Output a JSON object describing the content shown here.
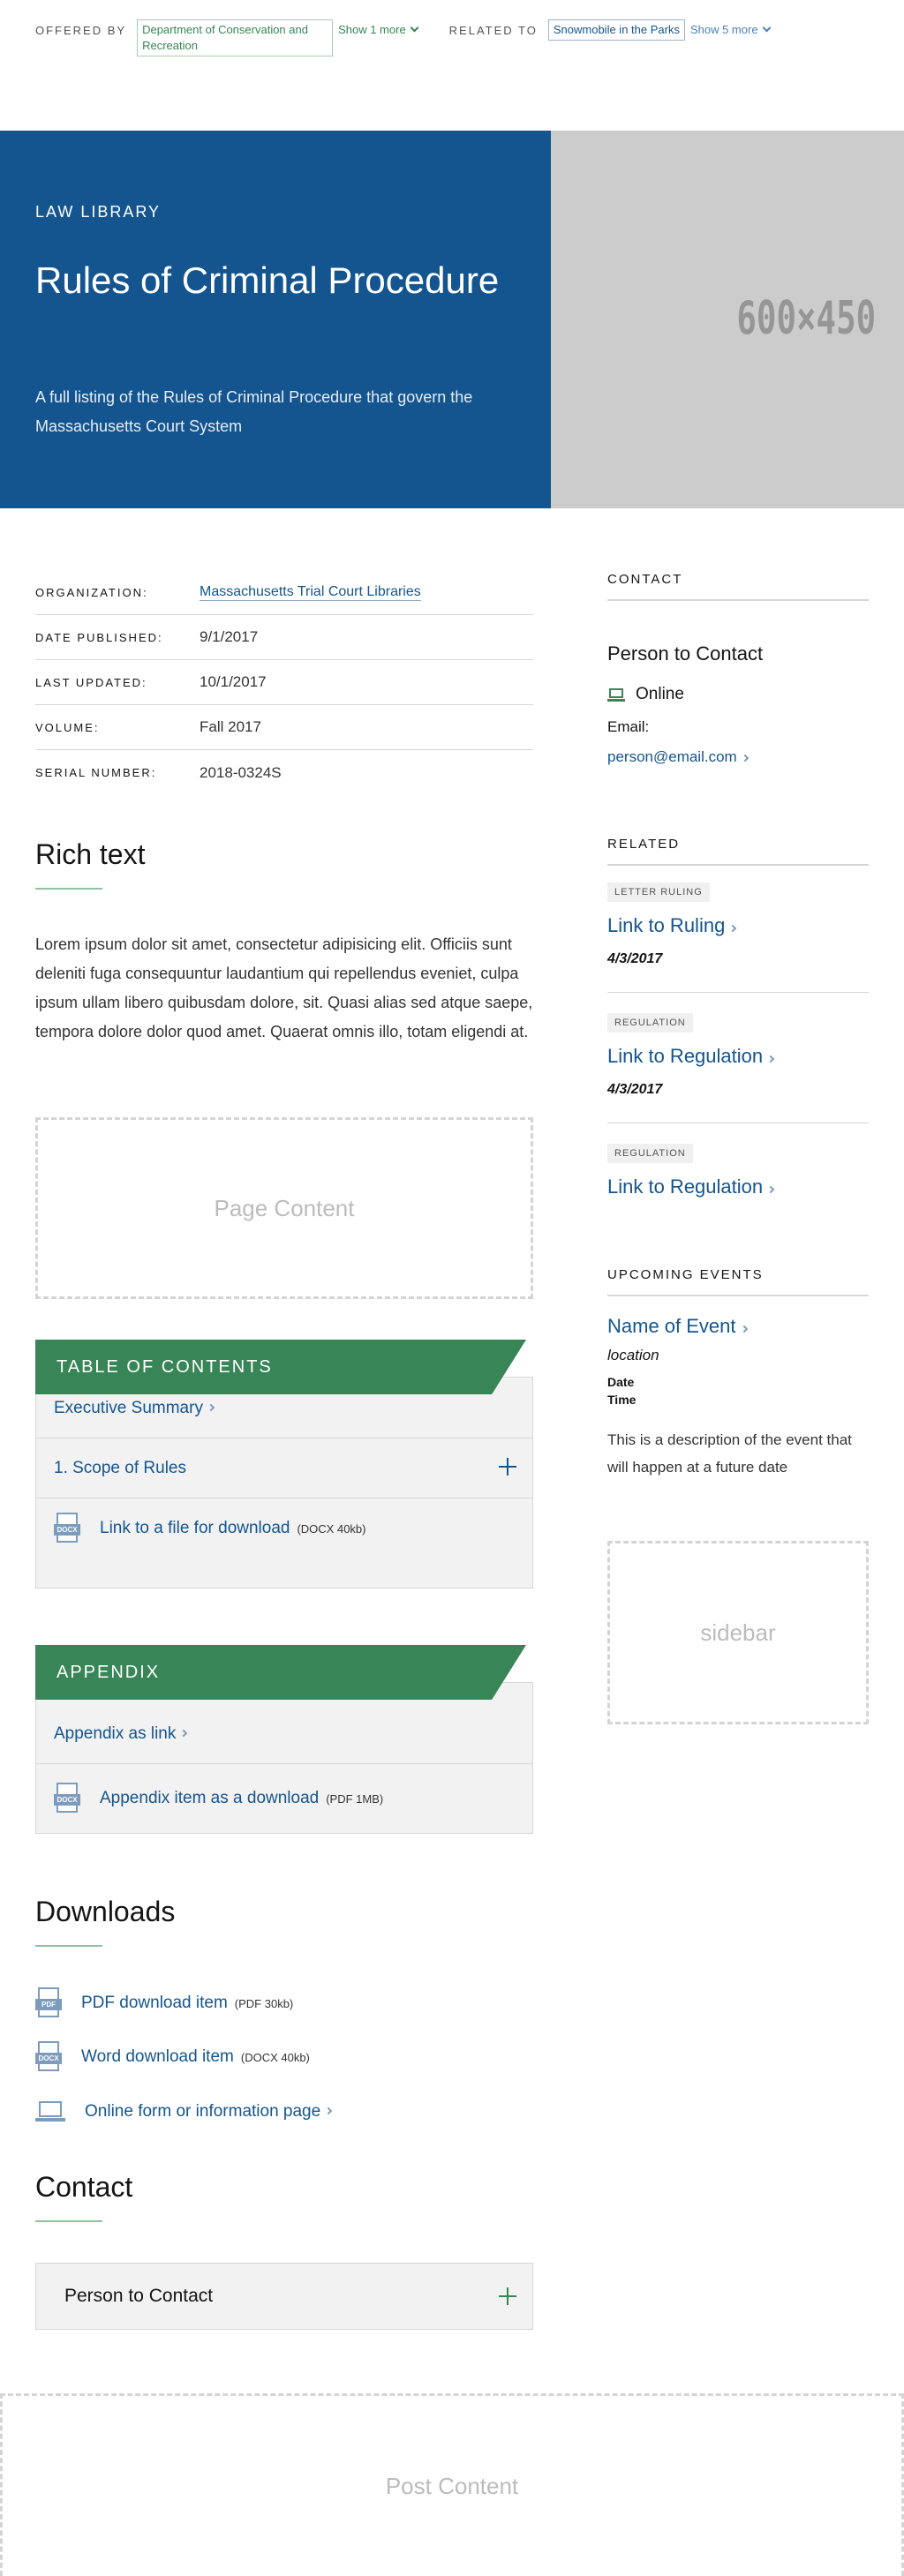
{
  "topbar": {
    "offered_by_label": "OFFERED BY",
    "offered_by": "Department of Conservation and Recreation",
    "offered_more": "Show 1 more",
    "related_to_label": "RELATED TO",
    "related_to": "Snowmobile in the Parks",
    "related_more": "Show 5 more"
  },
  "hero": {
    "category": "LAW LIBRARY",
    "title": "Rules of Criminal Procedure",
    "description": "A full listing of the Rules of Criminal Procedure that govern the Massachusetts Court System",
    "image_placeholder": "600×450"
  },
  "details": [
    {
      "label": "ORGANIZATION:",
      "value": "Massachusetts Trial Court Libraries"
    },
    {
      "label": "DATE PUBLISHED:",
      "value": "9/1/2017"
    },
    {
      "label": "LAST UPDATED:",
      "value": "10/1/2017"
    },
    {
      "label": "VOLUME:",
      "value": "Fall 2017"
    },
    {
      "label": "SERIAL NUMBER:",
      "value": "2018-0324S"
    }
  ],
  "rich_text": {
    "heading": "Rich text",
    "body": "Lorem ipsum dolor sit amet, consectetur adipisicing elit. Officiis sunt deleniti fuga consequuntur laudantium qui repellendus eveniet, culpa ipsum ullam libero quibusdam dolore, sit. Quasi alias sed atque saepe, tempora dolore dolor quod amet. Quaerat omnis illo, totam eligendi at."
  },
  "page_content_placeholder": "Page Content",
  "toc": {
    "title": "TABLE OF CONTENTS",
    "items": [
      {
        "label": "Executive Summary"
      },
      {
        "label": "1. Scope of Rules"
      },
      {
        "label": "Link to a file for download",
        "meta": "(DOCX 40kb)",
        "icon": "DOCX"
      }
    ]
  },
  "appendix": {
    "title": "APPENDIX",
    "items": [
      {
        "label": "Appendix as link"
      },
      {
        "label": "Appendix item as a download",
        "meta": "(PDF 1MB)",
        "icon": "DOCX"
      }
    ]
  },
  "downloads": {
    "heading": "Downloads",
    "items": [
      {
        "label": "PDF download item",
        "meta": "(PDF 30kb)",
        "icon": "PDF"
      },
      {
        "label": "Word download item",
        "meta": "(DOCX 40kb)",
        "icon": "DOCX"
      },
      {
        "label": "Online form or information page"
      }
    ]
  },
  "contact_section": {
    "heading": "Contact",
    "person": "Person to Contact"
  },
  "post_content_placeholder": "Post Content",
  "sidebar": {
    "contact": {
      "heading": "CONTACT",
      "person": "Person to Contact",
      "online": "Online",
      "email_label": "Email:",
      "email": "person@email.com"
    },
    "related": {
      "heading": "RELATED",
      "items": [
        {
          "tag": "LETTER RULING",
          "link": "Link to Ruling",
          "date": "4/3/2017"
        },
        {
          "tag": "REGULATION",
          "link": "Link to Regulation",
          "date": "4/3/2017"
        },
        {
          "tag": "REGULATION",
          "link": "Link to Regulation"
        }
      ]
    },
    "events": {
      "heading": "UPCOMING EVENTS",
      "name": "Name of Event",
      "location": "location",
      "date": "Date",
      "time": "Time",
      "description": "This is a description of the event that will happen at a future date"
    },
    "sidebar_placeholder": "sidebar"
  },
  "colors": {
    "primary_blue": "#14558f",
    "primary_green": "#388557",
    "placeholder_gray": "#cccccc"
  }
}
